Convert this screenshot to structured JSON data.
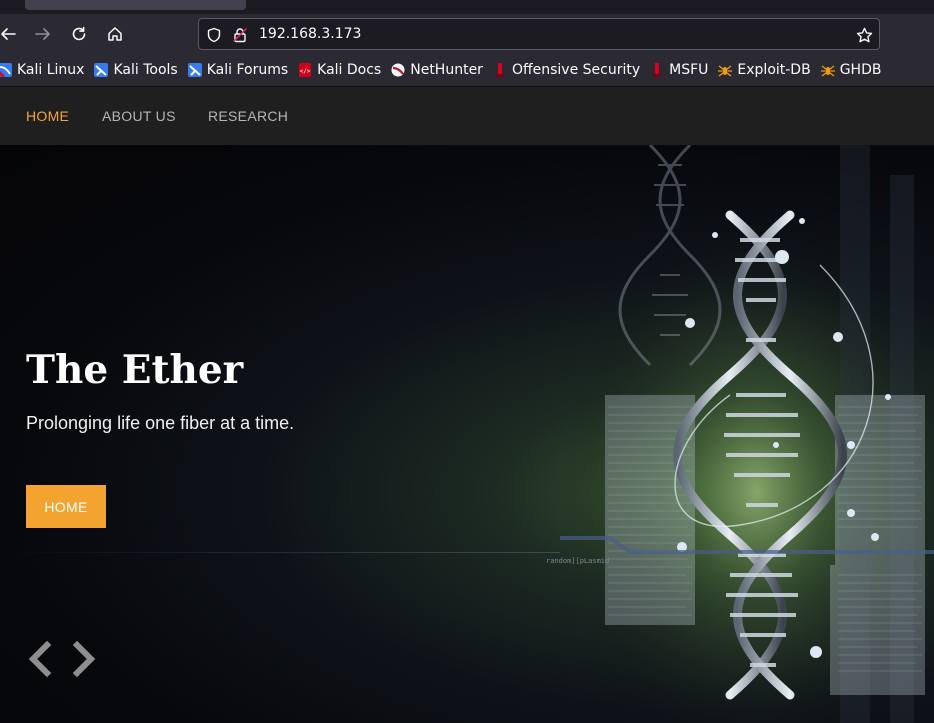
{
  "browser": {
    "url": "192.168.3.173",
    "bookmarks": [
      {
        "label": "Kali Linux",
        "icon": "kali-linux-icon"
      },
      {
        "label": "Kali Tools",
        "icon": "kali-tools-icon"
      },
      {
        "label": "Kali Forums",
        "icon": "kali-forums-icon"
      },
      {
        "label": "Kali Docs",
        "icon": "kali-docs-icon"
      },
      {
        "label": "NetHunter",
        "icon": "nethunter-icon"
      },
      {
        "label": "Offensive Security",
        "icon": "offsec-icon"
      },
      {
        "label": "MSFU",
        "icon": "msfu-icon"
      },
      {
        "label": "Exploit-DB",
        "icon": "exploit-db-icon"
      },
      {
        "label": "GHDB",
        "icon": "ghdb-icon"
      }
    ]
  },
  "site": {
    "nav": [
      {
        "label": "HOME",
        "active": true
      },
      {
        "label": "ABOUT US",
        "active": false
      },
      {
        "label": "RESEARCH",
        "active": false
      }
    ],
    "hero": {
      "title": "The Ether",
      "subtitle": "Prolonging life one fiber at a time.",
      "button_label": "HOME",
      "art_caption": "random][pLasmid"
    }
  },
  "colors": {
    "accent": "#f3a430",
    "nav_bg": "#1f1f1f",
    "chrome_bg": "#2b2a33"
  }
}
